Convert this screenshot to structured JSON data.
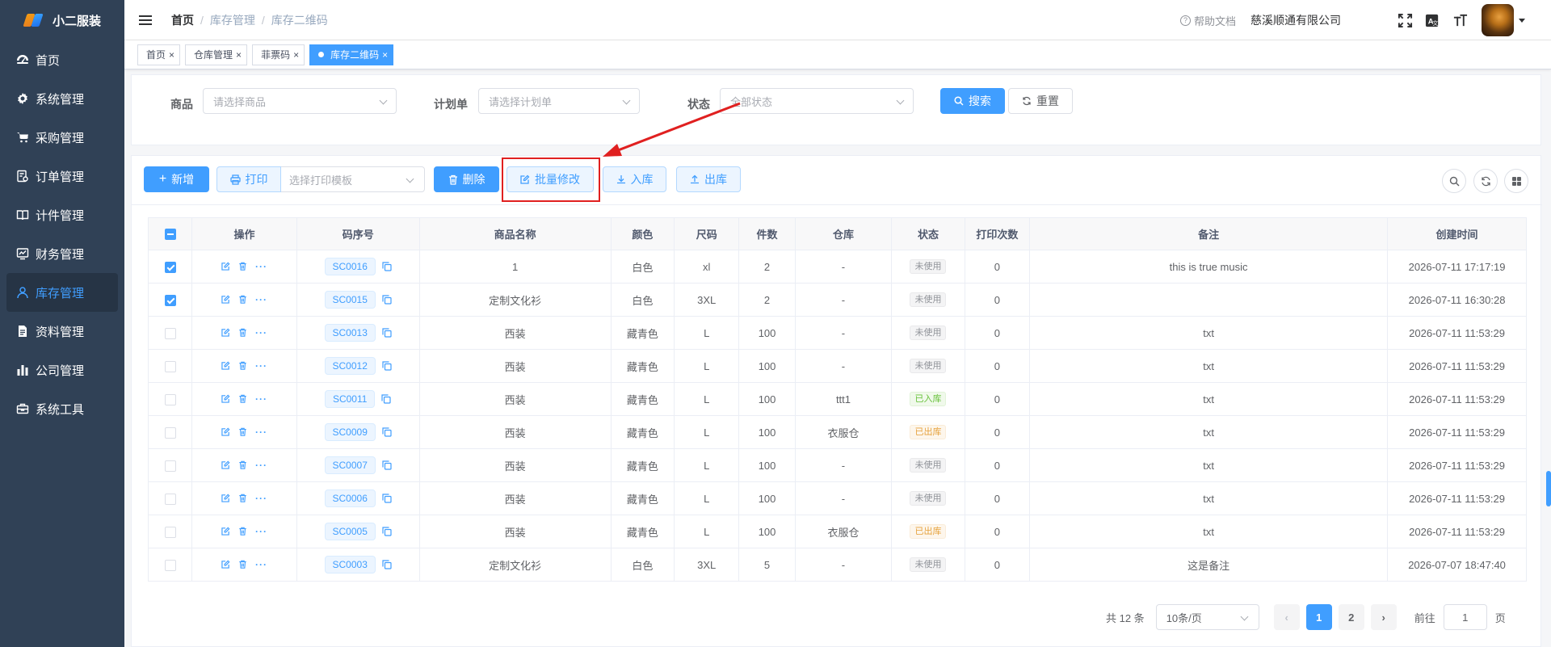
{
  "app": {
    "name": "小二服装",
    "company": "慈溪顺通有限公司",
    "help": "帮助文档"
  },
  "sidebar": {
    "items": [
      {
        "label": "首页",
        "icon": "dashboard-icon"
      },
      {
        "label": "系统管理",
        "icon": "gear-icon"
      },
      {
        "label": "采购管理",
        "icon": "cart-icon"
      },
      {
        "label": "订单管理",
        "icon": "order-icon"
      },
      {
        "label": "计件管理",
        "icon": "book-icon"
      },
      {
        "label": "财务管理",
        "icon": "chart-icon"
      },
      {
        "label": "库存管理",
        "icon": "user-icon"
      },
      {
        "label": "资料管理",
        "icon": "document-icon"
      },
      {
        "label": "公司管理",
        "icon": "bar-chart-icon"
      },
      {
        "label": "系统工具",
        "icon": "toolbox-icon"
      }
    ],
    "active_index": 6
  },
  "breadcrumb": {
    "home": "首页",
    "level1": "库存管理",
    "level2": "库存二维码"
  },
  "tags": [
    {
      "label": "首页",
      "active": false
    },
    {
      "label": "仓库管理",
      "active": false
    },
    {
      "label": "菲票码",
      "active": false
    },
    {
      "label": "库存二维码",
      "active": true
    }
  ],
  "search": {
    "product_label": "商品",
    "product_placeholder": "请选择商品",
    "plan_label": "计划单",
    "plan_placeholder": "请选择计划单",
    "status_label": "状态",
    "status_placeholder": "全部状态",
    "search_button": "搜索",
    "reset_button": "重置"
  },
  "toolbar": {
    "add": "新增",
    "print": "打印",
    "print_template_placeholder": "选择打印模板",
    "delete": "删除",
    "batch_edit": "批量修改",
    "stock_in": "入库",
    "stock_out": "出库"
  },
  "table": {
    "headers": [
      "操作",
      "码序号",
      "商品名称",
      "颜色",
      "尺码",
      "件数",
      "仓库",
      "状态",
      "打印次数",
      "备注",
      "创建时间"
    ],
    "rows": [
      {
        "checked": true,
        "code": "SC0016",
        "name": "1",
        "color": "白色",
        "size": "xl",
        "qty": "2",
        "warehouse": "-",
        "status": "未使用",
        "status_type": "unused",
        "prints": "0",
        "remark": "this is true music",
        "created": "2026-07-11 17:17:19"
      },
      {
        "checked": true,
        "code": "SC0015",
        "name": "定制文化衫",
        "color": "白色",
        "size": "3XL",
        "qty": "2",
        "warehouse": "-",
        "status": "未使用",
        "status_type": "unused",
        "prints": "0",
        "remark": "",
        "created": "2026-07-11 16:30:28"
      },
      {
        "checked": false,
        "code": "SC0013",
        "name": "西装",
        "color": "藏青色",
        "size": "L",
        "qty": "100",
        "warehouse": "-",
        "status": "未使用",
        "status_type": "unused",
        "prints": "0",
        "remark": "txt",
        "created": "2026-07-11 11:53:29"
      },
      {
        "checked": false,
        "code": "SC0012",
        "name": "西装",
        "color": "藏青色",
        "size": "L",
        "qty": "100",
        "warehouse": "-",
        "status": "未使用",
        "status_type": "unused",
        "prints": "0",
        "remark": "txt",
        "created": "2026-07-11 11:53:29"
      },
      {
        "checked": false,
        "code": "SC0011",
        "name": "西装",
        "color": "藏青色",
        "size": "L",
        "qty": "100",
        "warehouse": "ttt1",
        "status": "已入库",
        "status_type": "in",
        "prints": "0",
        "remark": "txt",
        "created": "2026-07-11 11:53:29"
      },
      {
        "checked": false,
        "code": "SC0009",
        "name": "西装",
        "color": "藏青色",
        "size": "L",
        "qty": "100",
        "warehouse": "衣服仓",
        "status": "已出库",
        "status_type": "out",
        "prints": "0",
        "remark": "txt",
        "created": "2026-07-11 11:53:29"
      },
      {
        "checked": false,
        "code": "SC0007",
        "name": "西装",
        "color": "藏青色",
        "size": "L",
        "qty": "100",
        "warehouse": "-",
        "status": "未使用",
        "status_type": "unused",
        "prints": "0",
        "remark": "txt",
        "created": "2026-07-11 11:53:29"
      },
      {
        "checked": false,
        "code": "SC0006",
        "name": "西装",
        "color": "藏青色",
        "size": "L",
        "qty": "100",
        "warehouse": "-",
        "status": "未使用",
        "status_type": "unused",
        "prints": "0",
        "remark": "txt",
        "created": "2026-07-11 11:53:29"
      },
      {
        "checked": false,
        "code": "SC0005",
        "name": "西装",
        "color": "藏青色",
        "size": "L",
        "qty": "100",
        "warehouse": "衣服仓",
        "status": "已出库",
        "status_type": "out",
        "prints": "0",
        "remark": "txt",
        "created": "2026-07-11 11:53:29"
      },
      {
        "checked": false,
        "code": "SC0003",
        "name": "定制文化衫",
        "color": "白色",
        "size": "3XL",
        "qty": "5",
        "warehouse": "-",
        "status": "未使用",
        "status_type": "unused",
        "prints": "0",
        "remark": "这是备注",
        "created": "2026-07-07 18:47:40"
      }
    ]
  },
  "pagination": {
    "total": "共 12 条",
    "page_size": "10条/页",
    "pages": [
      "1",
      "2"
    ],
    "current": "1",
    "goto_label": "前往",
    "goto_value": "1",
    "page_suffix": "页"
  },
  "colors": {
    "sidebar_bg": "#304156",
    "primary": "#409eff",
    "annotation": "#e02020"
  }
}
